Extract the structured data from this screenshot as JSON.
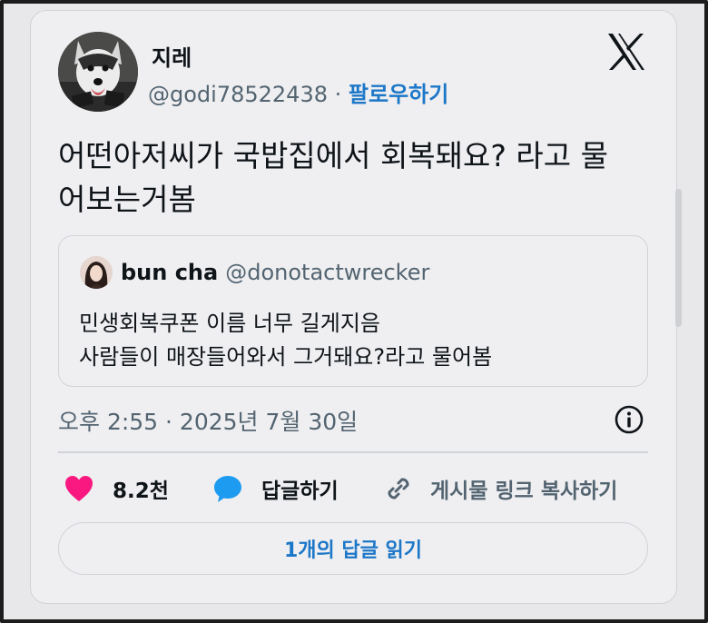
{
  "post": {
    "author_name": "지레",
    "author_handle": "@godi78522438",
    "separator": "·",
    "follow_label": "팔로우하기",
    "text_line1": "어떤아저씨가 국밥집에서 회복돼요? 라고 물",
    "text_line2": "어보는거봄",
    "timestamp": "오후 2:55 · 2025년 7월 30일"
  },
  "quote": {
    "author_name": "bun cha",
    "author_handle": "@donotactwrecker",
    "text_line1": "민생회복쿠폰 이름 너무 길게지음",
    "text_line2": "사람들이 매장들어와서 그거돼요?라고 물어봄"
  },
  "actions": {
    "like_count": "8.2천",
    "reply_label": "답글하기",
    "copy_link_label": "게시물 링크 복사하기"
  },
  "read_replies_label": "1개의 답글 읽기",
  "icons": {
    "like": "heart-icon",
    "reply": "speech-bubble-icon",
    "copy": "link-icon",
    "info": "info-icon",
    "brand": "x-logo-icon"
  },
  "colors": {
    "like": "#f91880",
    "reply": "#1d9bf0",
    "link_text": "#1d77c8",
    "muted_text": "#536471"
  }
}
